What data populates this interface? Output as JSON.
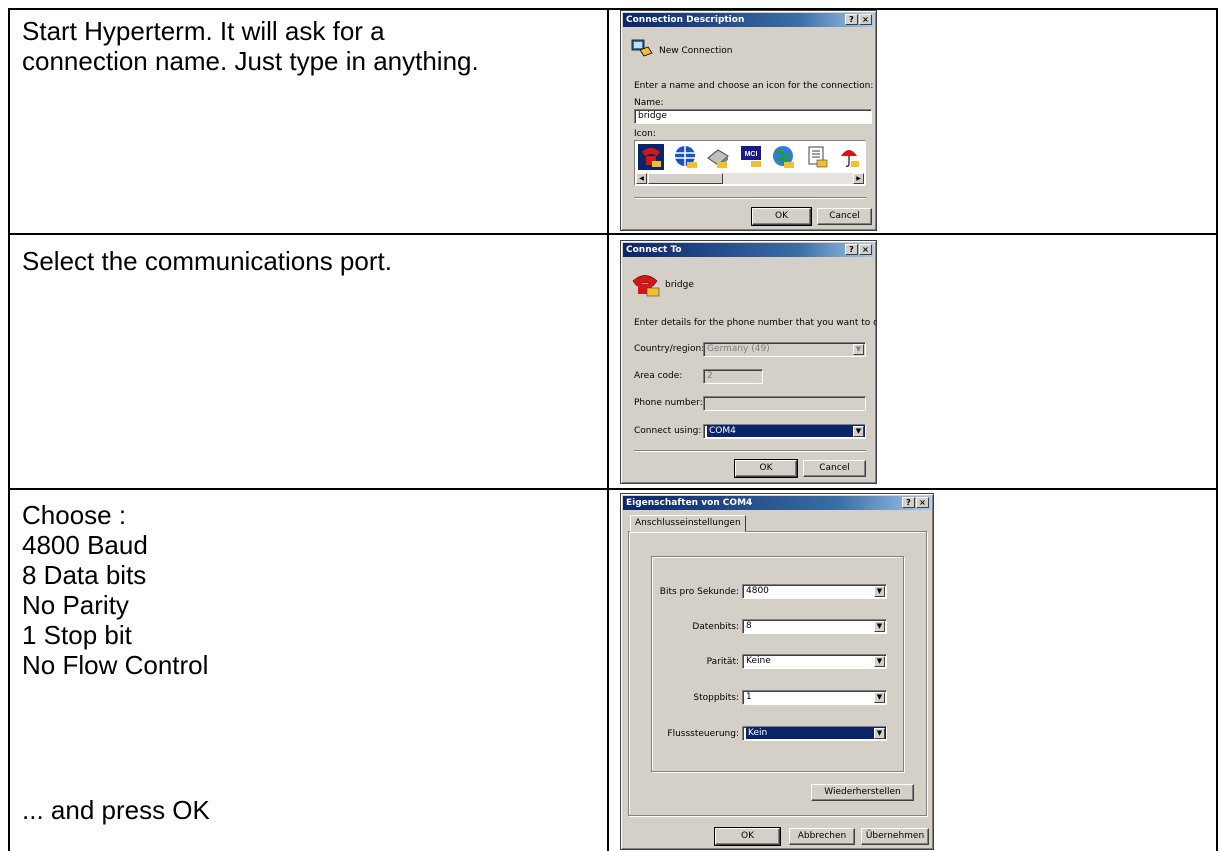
{
  "rows": [
    {
      "lines": [
        "Start Hyperterm. It will ask for a",
        "connection name. Just type in anything."
      ]
    },
    {
      "lines": [
        "Select the communications port."
      ]
    },
    {
      "lines": [
        "Choose :",
        "4800 Baud",
        "8 Data bits",
        "No Parity",
        "1 Stop bit",
        "No Flow Control"
      ],
      "footer": "... and press OK"
    }
  ],
  "dialog1": {
    "title": "Connection Description",
    "help": "?",
    "close": "×",
    "heading": "New Connection",
    "prompt": "Enter a name and choose an icon for the connection:",
    "name_label": "Name:",
    "name_value": "bridge",
    "icon_label": "Icon:",
    "icon_names": [
      "phone-icon",
      "globe-icon",
      "modem-icon",
      "mci-icon",
      "network-globe-icon",
      "documents-icon",
      "umbrella-icon"
    ],
    "icon_mci_text": "MCI",
    "ok": "OK",
    "cancel": "Cancel"
  },
  "dialog2": {
    "title": "Connect To",
    "help": "?",
    "close": "×",
    "heading": "bridge",
    "prompt": "Enter details for the phone number that you want to dial:",
    "country_label": "Country/region:",
    "country_value": "Germany (49)",
    "area_label": "Area code:",
    "area_value": "2",
    "phone_label": "Phone number:",
    "phone_value": "",
    "connect_label": "Connect using:",
    "connect_value": "COM4",
    "ok": "OK",
    "cancel": "Cancel"
  },
  "dialog3": {
    "title": "Eigenschaften von COM4",
    "help": "?",
    "close": "×",
    "tab": "Anschlusseinstellungen",
    "bits_label": "Bits pro Sekunde:",
    "bits_value": "4800",
    "data_label": "Datenbits:",
    "data_value": "8",
    "parity_label": "Parität:",
    "parity_value": "Keine",
    "stop_label": "Stoppbits:",
    "stop_value": "1",
    "flow_label": "Flusssteuerung:",
    "flow_value": "Kein",
    "restore": "Wiederherstellen",
    "ok": "OK",
    "cancel": "Abbrechen",
    "apply": "Übernehmen"
  },
  "colors": {
    "titlebar": "#0a246a",
    "dialog_face": "#d4d0c8",
    "selection": "#0a246a"
  }
}
